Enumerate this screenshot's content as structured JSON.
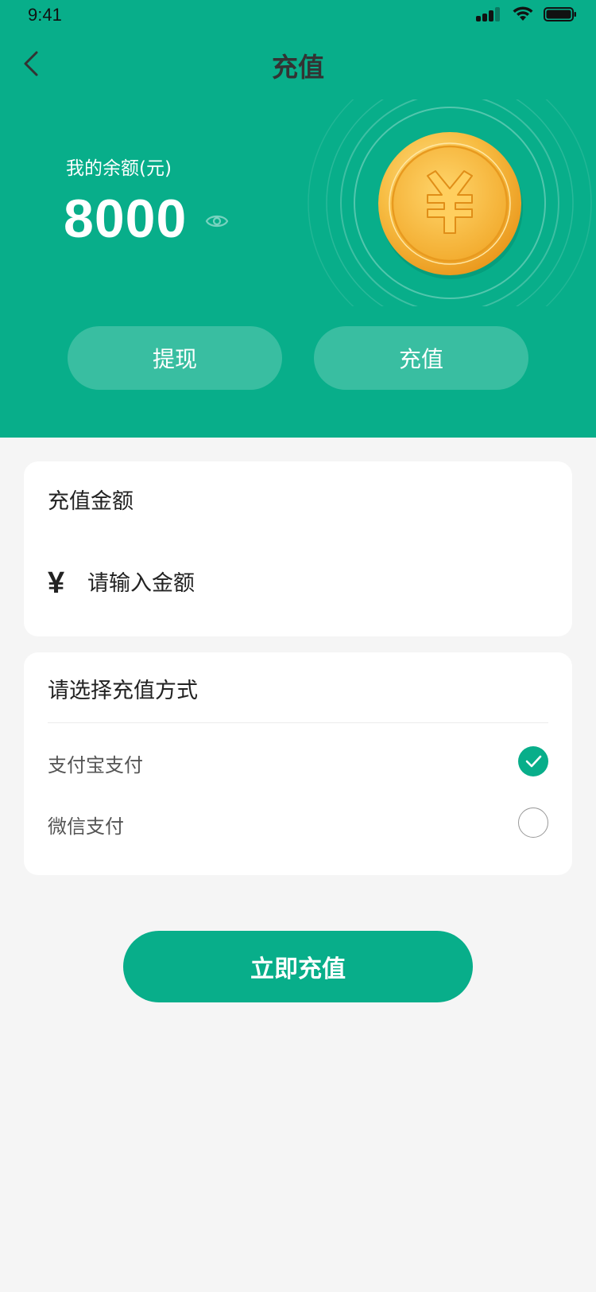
{
  "status_bar": {
    "time": "9:41"
  },
  "nav": {
    "title": "充值"
  },
  "balance": {
    "label": "我的余额(元)",
    "value": "8000"
  },
  "actions": {
    "withdraw_label": "提现",
    "recharge_label": "充值"
  },
  "amount_card": {
    "title": "充值金额",
    "currency_symbol": "¥",
    "placeholder": "请输入金额"
  },
  "method_card": {
    "title": "请选择充值方式",
    "options": [
      {
        "label": "支付宝支付",
        "selected": true
      },
      {
        "label": "微信支付",
        "selected": false
      }
    ]
  },
  "submit": {
    "label": "立即充值"
  },
  "colors": {
    "primary": "#08ae8a",
    "coin": "#f5b73a",
    "background": "#f5f5f5"
  },
  "icons": [
    "back-arrow-icon",
    "eye-icon",
    "coin-yen-icon",
    "check-icon",
    "signal-icon",
    "wifi-icon",
    "battery-icon"
  ]
}
